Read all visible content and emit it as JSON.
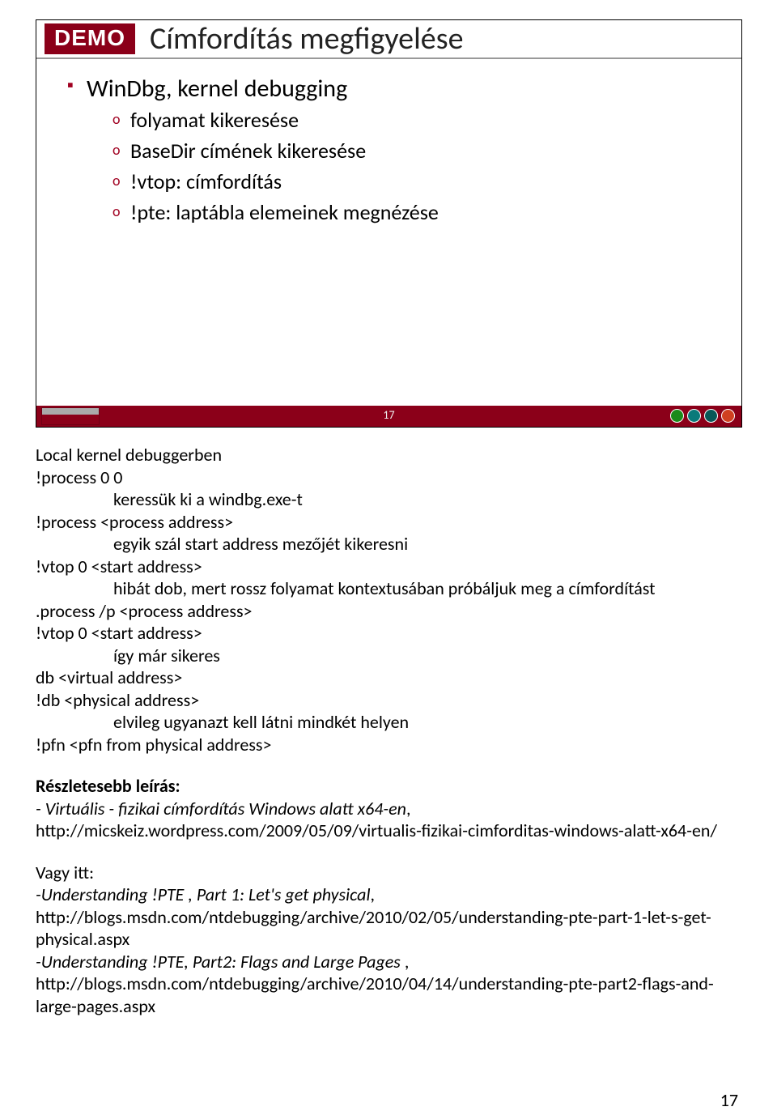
{
  "slide": {
    "demo_label": "DEMO",
    "title": "Címfordítás megfigyelése",
    "bullet1": "WinDbg, kernel debugging",
    "sub": [
      "folyamat kikeresése",
      "BaseDir címének kikeresése",
      "!vtop: címfordítás",
      "!pte: laptábla elemeinek megnézése"
    ],
    "footer_page": "17"
  },
  "notes": {
    "l01": "Local kernel debuggerben",
    "l02": "!process 0 0",
    "l03": "keressük ki a windbg.exe-t",
    "l04": "!process <process address>",
    "l05": "egyik szál start address mezőjét kikeresni",
    "l06": "!vtop 0 <start address>",
    "l07": "hibát dob, mert rossz folyamat kontextusában próbáljuk meg a címfordítást",
    "l08": ".process /p <process address>",
    "l09": "!vtop 0 <start address>",
    "l10": "így már sikeres",
    "l11": "db <virtual address>",
    "l12": "!db <physical address>",
    "l13": "elvileg ugyanazt kell látni mindkét helyen",
    "l14": "!pfn <pfn from physical address>",
    "section_title": "Részletesebb leírás:",
    "vf_title": "- Virtuális - fizikai címfordítás Windows alatt x64-en",
    "vf_sep": ",",
    "vf_url1": "http://micskeiz.wordpress.com/2009/05/09/virtualis-fizikai-cimforditas-windows-alatt-x64-en/",
    "vagy": "Vagy itt:",
    "pte1_label": "-Understanding !PTE , Part 1: Let's get physical",
    "pte1_url": "http://blogs.msdn.com/ntdebugging/archive/2010/02/05/understanding-pte-part-1-let-s-get-physical.aspx",
    "pte2_label": "-Understanding !PTE, Part2: Flags and Large Pages",
    "pte2_sep": " ,",
    "pte2_url": "http://blogs.msdn.com/ntdebugging/archive/2010/04/14/understanding-pte-part2-flags-and-large-pages.aspx"
  },
  "page_number_bottom": "17"
}
